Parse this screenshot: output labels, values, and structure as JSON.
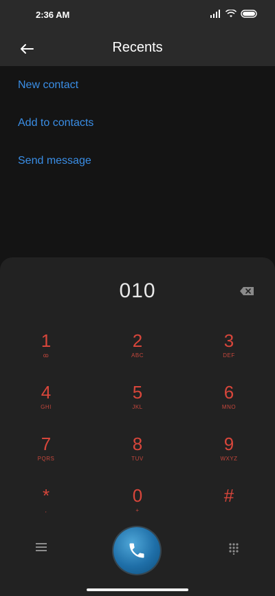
{
  "status": {
    "time": "2:36 AM"
  },
  "header": {
    "title": "Recents"
  },
  "actions": {
    "new_contact": "New contact",
    "add_to_contacts": "Add to contacts",
    "send_message": "Send message"
  },
  "dialer": {
    "number": "010",
    "keys": [
      {
        "digit": "1",
        "letters": "ꝏ"
      },
      {
        "digit": "2",
        "letters": "ABC"
      },
      {
        "digit": "3",
        "letters": "DEF"
      },
      {
        "digit": "4",
        "letters": "GHI"
      },
      {
        "digit": "5",
        "letters": "JKL"
      },
      {
        "digit": "6",
        "letters": "MNO"
      },
      {
        "digit": "7",
        "letters": "PQRS"
      },
      {
        "digit": "8",
        "letters": "TUV"
      },
      {
        "digit": "9",
        "letters": "WXYZ"
      },
      {
        "digit": "*",
        "letters": ","
      },
      {
        "digit": "0",
        "letters": "+"
      },
      {
        "digit": "#",
        "letters": ""
      }
    ]
  },
  "icons": {
    "back": "arrow-left-icon",
    "backspace": "backspace-icon",
    "menu": "menu-icon",
    "call": "phone-icon",
    "keypad": "keypad-icon"
  },
  "colors": {
    "background": "#141414",
    "panel": "#222222",
    "accent_text": "#3a8ee6",
    "dial_digits": "#d8463b"
  }
}
